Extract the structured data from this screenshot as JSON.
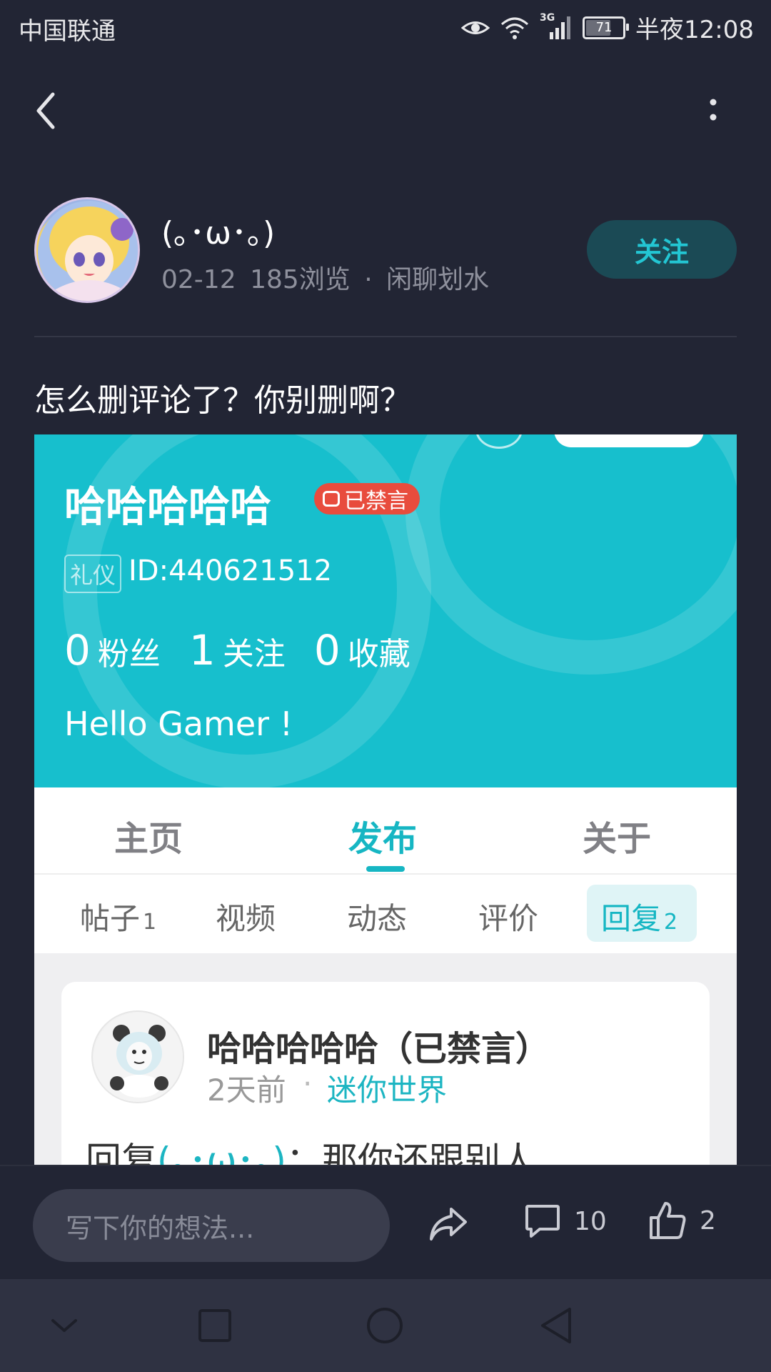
{
  "status_bar": {
    "carrier": "中国联通",
    "network": "3G",
    "battery": "71",
    "battery_level": 0.71,
    "time": "半夜12:08"
  },
  "post": {
    "author": "(｡･ω･｡)",
    "date": "02-12",
    "views": "185浏览",
    "separator": "·",
    "category": "闲聊划水",
    "follow_label": "关注",
    "text": "怎么删评论了？你别删啊？"
  },
  "screenshot": {
    "username": "哈哈哈哈哈",
    "banned_badge": "已禁言",
    "etiquette_tag": "礼仪",
    "user_id": "ID:440621512",
    "stats": [
      {
        "num": "0",
        "label": "粉丝"
      },
      {
        "num": "1",
        "label": "关注"
      },
      {
        "num": "0",
        "label": "收藏"
      }
    ],
    "bio": "Hello Gamer !",
    "tabs": [
      "主页",
      "发布",
      "关于"
    ],
    "sub_tabs": [
      {
        "label": "帖子",
        "count": "1"
      },
      {
        "label": "视频",
        "count": ""
      },
      {
        "label": "动态",
        "count": ""
      },
      {
        "label": "评价",
        "count": ""
      },
      {
        "label": "回复",
        "count": "2"
      }
    ],
    "reply_card": {
      "name": "哈哈哈哈哈（已禁言）",
      "time": "2天前",
      "dot": "·",
      "game": "迷你世界",
      "text_prefix": "回复",
      "mention": "(｡･ω･｡)",
      "text_suffix": "：那你还跟别人"
    }
  },
  "action_bar": {
    "input_placeholder": "写下你的想法...",
    "comment_count": "10",
    "like_count": "2"
  },
  "colors": {
    "background": "#222534",
    "accent": "#23c6d3",
    "screenshot_header": "#17bfcd",
    "banned_red": "#e84c3d"
  }
}
